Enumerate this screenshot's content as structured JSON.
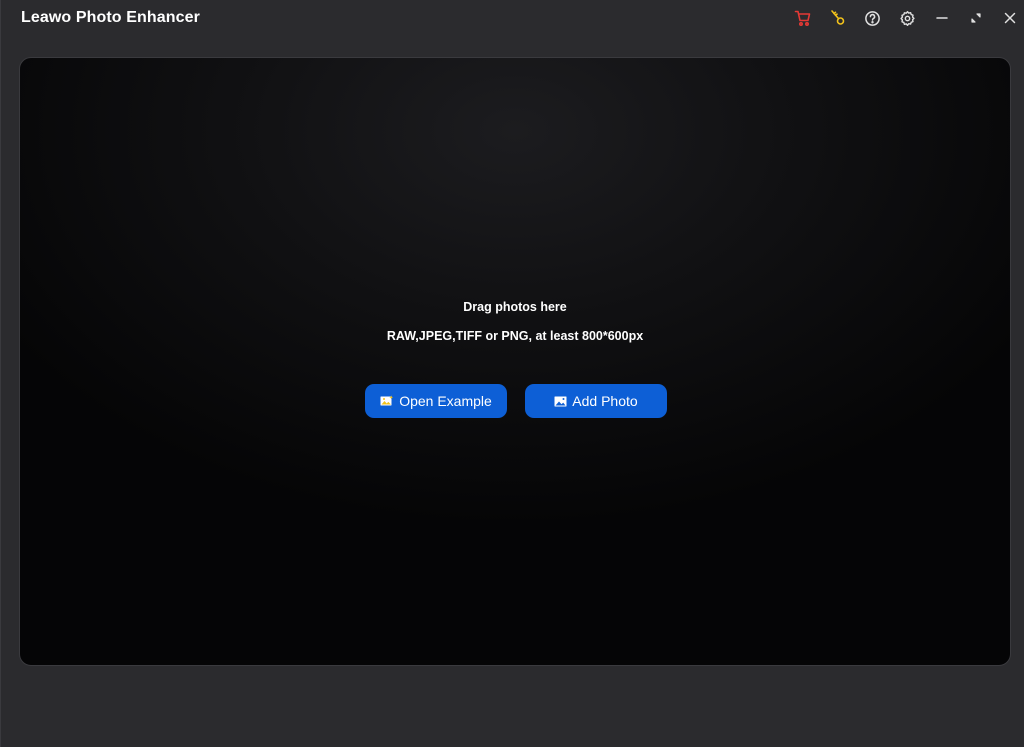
{
  "window": {
    "title": "Leawo Photo Enhancer"
  },
  "titlebar": {
    "icons": [
      "cart-icon",
      "key-icon",
      "help-icon",
      "settings-icon",
      "minimize-icon",
      "restore-icon",
      "close-icon"
    ],
    "colors": {
      "cart": "#e53935",
      "key": "#f2c21b",
      "default": "#e0e0e0"
    }
  },
  "drop_area": {
    "heading": "Drag photos here",
    "subheading": "RAW,JPEG,TIFF or PNG, at least 800*600px"
  },
  "buttons": {
    "open_example": "Open Example",
    "add_photo": "Add Photo"
  },
  "colors": {
    "accent": "#0d5fd6",
    "background": "#2b2b2e",
    "drop_area": "#111113"
  }
}
